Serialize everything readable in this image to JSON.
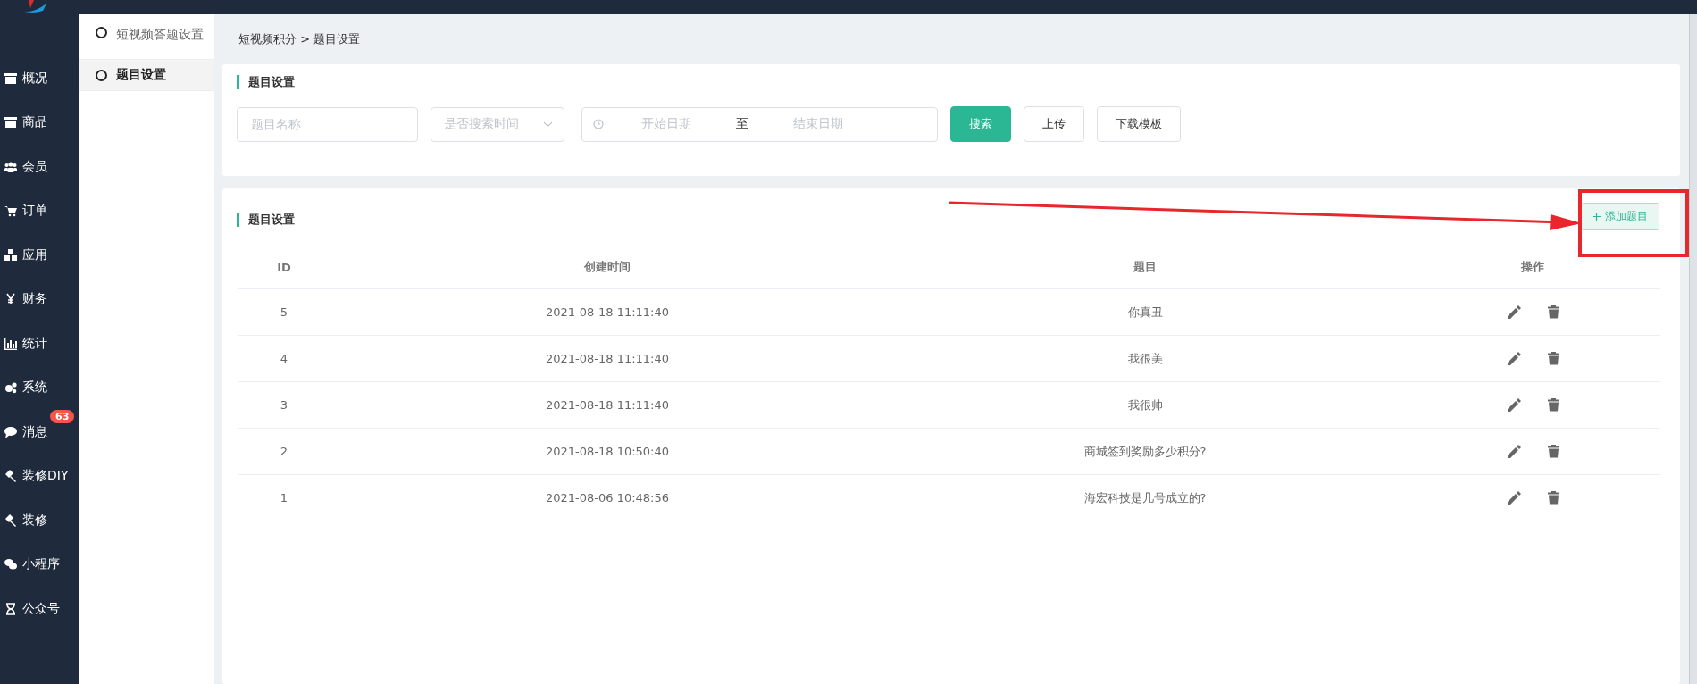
{
  "nav": [
    {
      "label": "概况"
    },
    {
      "label": "商品"
    },
    {
      "label": "会员"
    },
    {
      "label": "订单"
    },
    {
      "label": "应用"
    },
    {
      "label": "财务"
    },
    {
      "label": "统计"
    },
    {
      "label": "系统"
    },
    {
      "label": "消息",
      "badge": "63"
    },
    {
      "label": "装修DIY"
    },
    {
      "label": "装修"
    },
    {
      "label": "小程序"
    },
    {
      "label": "公众号"
    }
  ],
  "submenu": [
    {
      "label": "短视频答题设置",
      "selected": false
    },
    {
      "label": "题目设置",
      "selected": true
    }
  ],
  "breadcrumb": "短视频积分 > 题目设置",
  "filter_card": {
    "title": "题目设置",
    "name_placeholder": "题目名称",
    "time_select_placeholder": "是否搜索时间",
    "start_placeholder": "开始日期",
    "separator": "至",
    "end_placeholder": "结束日期",
    "buttons": [
      {
        "label": "搜索",
        "kind": "primary"
      },
      {
        "label": "上传",
        "kind": "default"
      },
      {
        "label": "下载模板",
        "kind": "default"
      }
    ]
  },
  "list_card": {
    "title": "题目设置",
    "add_button": "添加题目",
    "columns": [
      "ID",
      "创建时间",
      "题目",
      "操作"
    ],
    "rows": [
      {
        "id": "5",
        "created": "2021-08-18 11:11:40",
        "question": "你真丑"
      },
      {
        "id": "4",
        "created": "2021-08-18 11:11:40",
        "question": "我很美"
      },
      {
        "id": "3",
        "created": "2021-08-18 11:11:40",
        "question": "我很帅"
      },
      {
        "id": "2",
        "created": "2021-08-18 10:50:40",
        "question": "商城签到奖励多少积分?"
      },
      {
        "id": "1",
        "created": "2021-08-06 10:48:56",
        "question": "海宏科技是几号成立的?"
      }
    ]
  }
}
